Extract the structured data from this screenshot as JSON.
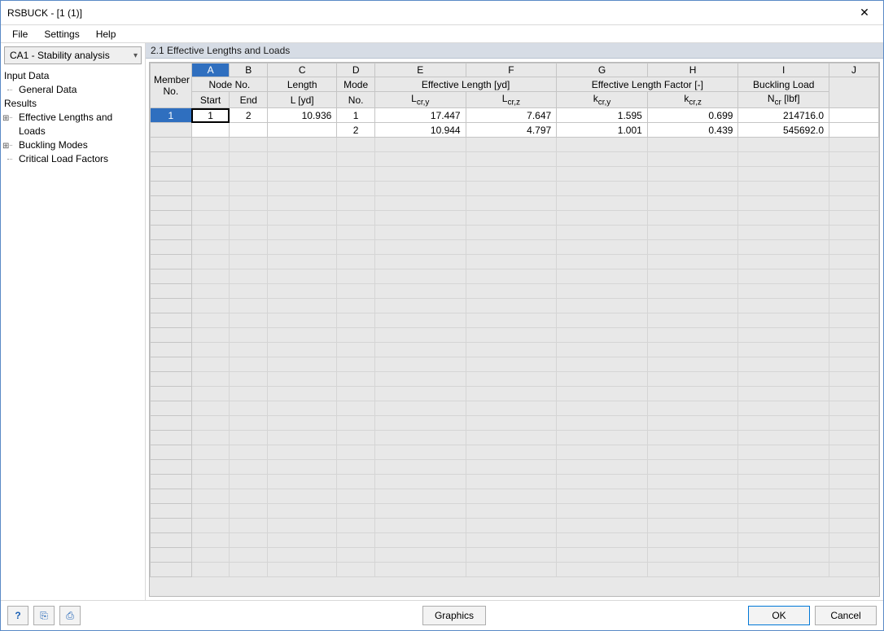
{
  "window": {
    "title": "RSBUCK - [1 (1)]"
  },
  "menu": {
    "file": "File",
    "settings": "Settings",
    "help": "Help"
  },
  "sidebar": {
    "combo": "CA1 - Stability analysis",
    "input_data": "Input Data",
    "general_data": "General Data",
    "results": "Results",
    "eff_len": "Effective Lengths and Loads",
    "buck_modes": "Buckling Modes",
    "crit_load": "Critical Load Factors"
  },
  "panel": {
    "title": "2.1 Effective Lengths and Loads"
  },
  "cols": {
    "letters": [
      "A",
      "B",
      "C",
      "D",
      "E",
      "F",
      "G",
      "H",
      "I",
      "J"
    ],
    "member_no": "Member\nNo.",
    "node_no": "Node No.",
    "start": "Start",
    "end": "End",
    "length": "Length",
    "length_u": "L [yd]",
    "mode": "Mode",
    "mode_no": "No.",
    "eff_len": "Effective Length [yd]",
    "lcry": "Lcr,y",
    "lcrz": "Lcr,z",
    "eff_fac": "Effective Length Factor [-]",
    "kcry": "kcr,y",
    "kcrz": "kcr,z",
    "buck_load": "Buckling Load",
    "ncr": "Ncr [lbf]"
  },
  "chart_data": {
    "type": "table",
    "columns": [
      "Member No.",
      "Node Start",
      "Node End",
      "Length L [yd]",
      "Mode No.",
      "Lcr,y",
      "Lcr,z",
      "kcr,y",
      "kcr,z",
      "Ncr [lbf]"
    ],
    "rows": [
      {
        "member": "1",
        "start": "1",
        "end": "2",
        "L": "10.936",
        "mode": "1",
        "Lcry": "17.447",
        "Lcrz": "7.647",
        "kcry": "1.595",
        "kcrz": "0.699",
        "Ncr": "214716.0"
      },
      {
        "member": "",
        "start": "",
        "end": "",
        "L": "",
        "mode": "2",
        "Lcry": "10.944",
        "Lcrz": "4.797",
        "kcry": "1.001",
        "kcrz": "0.439",
        "Ncr": "545692.0"
      }
    ]
  },
  "footer": {
    "graphics": "Graphics",
    "ok": "OK",
    "cancel": "Cancel"
  }
}
